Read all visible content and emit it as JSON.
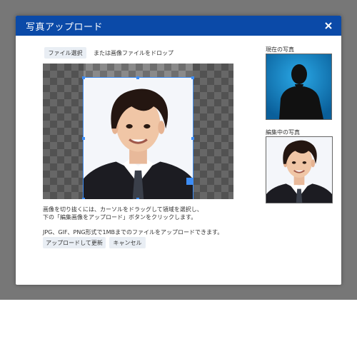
{
  "modal": {
    "title": "写真アップロード",
    "close_icon": "close-icon"
  },
  "upload": {
    "file_select_label": "ファイル選択",
    "drop_hint": "または画像ファイルをドロップ"
  },
  "current_photo": {
    "label": "現在の写真"
  },
  "editing_photo": {
    "label": "編集中の写真"
  },
  "instructions": {
    "line1": "画像を切り抜くには、カーソルをドラッグして領域を選択し、",
    "line2": "下の「編集画像をアップロード」ボタンをクリックします。",
    "formats": "JPG、GIF、PNG形式で1MBまでのファイルをアップロードできます。"
  },
  "actions": {
    "upload_label": "アップロードして更新",
    "cancel_label": "キャンセル"
  },
  "colors": {
    "header": "#0b4aa8",
    "accent": "#3d8df5",
    "silhouette_bg": "#0f86c8"
  }
}
